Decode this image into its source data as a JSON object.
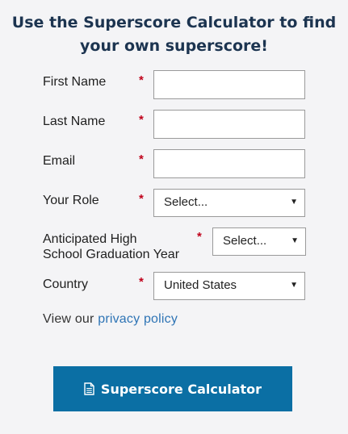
{
  "heading": {
    "line1": "Use the Superscore Calculator to find",
    "line2": "your own superscore!"
  },
  "form": {
    "required_marker": "*",
    "first_name": {
      "label": "First Name",
      "value": ""
    },
    "last_name": {
      "label": "Last Name",
      "value": ""
    },
    "email": {
      "label": "Email",
      "value": ""
    },
    "role": {
      "label": "Your Role",
      "selected": "Select..."
    },
    "grad_year": {
      "label_line1": "Anticipated High",
      "label_line2": "School Graduation Year",
      "selected": "Select..."
    },
    "country": {
      "label": "Country",
      "selected": "United States"
    },
    "arrow": "▼"
  },
  "privacy": {
    "prefix": "View our ",
    "link": "privacy policy"
  },
  "button": {
    "label": "Superscore Calculator",
    "icon": "document-icon"
  },
  "colors": {
    "accent": "#0b6fa4",
    "required": "#c0001a",
    "heading": "#1c3450",
    "link": "#2e74b5"
  }
}
